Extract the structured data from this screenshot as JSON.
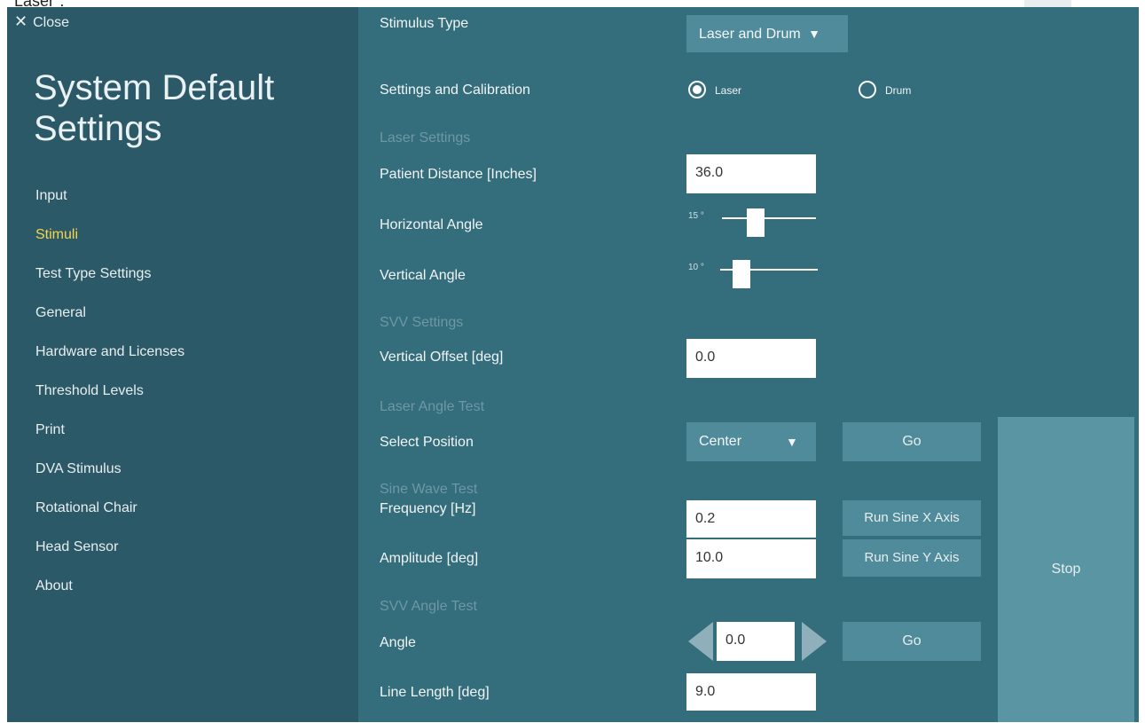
{
  "caption": "Laser\".",
  "sidebar": {
    "close_label": "Close",
    "title_line1": "System Default",
    "title_line2": "Settings",
    "items": [
      {
        "label": "Input"
      },
      {
        "label": "Stimuli",
        "active": true
      },
      {
        "label": "Test Type Settings"
      },
      {
        "label": "General"
      },
      {
        "label": "Hardware and Licenses"
      },
      {
        "label": "Threshold Levels"
      },
      {
        "label": "Print"
      },
      {
        "label": "DVA Stimulus"
      },
      {
        "label": "Rotational Chair"
      },
      {
        "label": "Head Sensor"
      },
      {
        "label": "About"
      }
    ]
  },
  "main": {
    "stimulus_type": {
      "label": "Stimulus Type",
      "value": "Laser and Drum"
    },
    "settings_calibration": {
      "label": "Settings and Calibration",
      "options": [
        "Laser",
        "Drum"
      ],
      "selected": "Laser"
    },
    "laser_settings": {
      "heading": "Laser Settings",
      "patient_distance_label": "Patient Distance  [Inches]",
      "patient_distance_value": "36.0",
      "horizontal_angle_label": "Horizontal Angle",
      "horizontal_angle_value": "15 °",
      "vertical_angle_label": "Vertical Angle",
      "vertical_angle_value": "10 °"
    },
    "svv_settings": {
      "heading": "SVV Settings",
      "vertical_offset_label": "Vertical Offset  [deg]",
      "vertical_offset_value": "0.0"
    },
    "laser_angle_test": {
      "heading": "Laser Angle Test",
      "select_position_label": "Select Position",
      "position_value": "Center",
      "go_label": "Go"
    },
    "sine_wave_test": {
      "heading": "Sine Wave Test",
      "frequency_label": "Frequency [Hz]",
      "frequency_value": "0.2",
      "amplitude_label": "Amplitude [deg]",
      "amplitude_value": "10.0",
      "run_x_label": "Run Sine X Axis",
      "run_y_label": "Run Sine Y Axis"
    },
    "svv_angle_test": {
      "heading": "SVV Angle Test",
      "angle_label": "Angle",
      "angle_value": "0.0",
      "go_label": "Go",
      "line_length_label": "Line Length [deg]",
      "line_length_value": "9.0"
    },
    "stop_label": "Stop"
  },
  "colors": {
    "sidebar_bg": "#2b5967",
    "main_bg": "#346d7c",
    "button_bg": "#4f8b9a",
    "stop_bg": "#5a95a3",
    "active_nav": "#f6d64a",
    "section_heading": "#6e98a4"
  }
}
